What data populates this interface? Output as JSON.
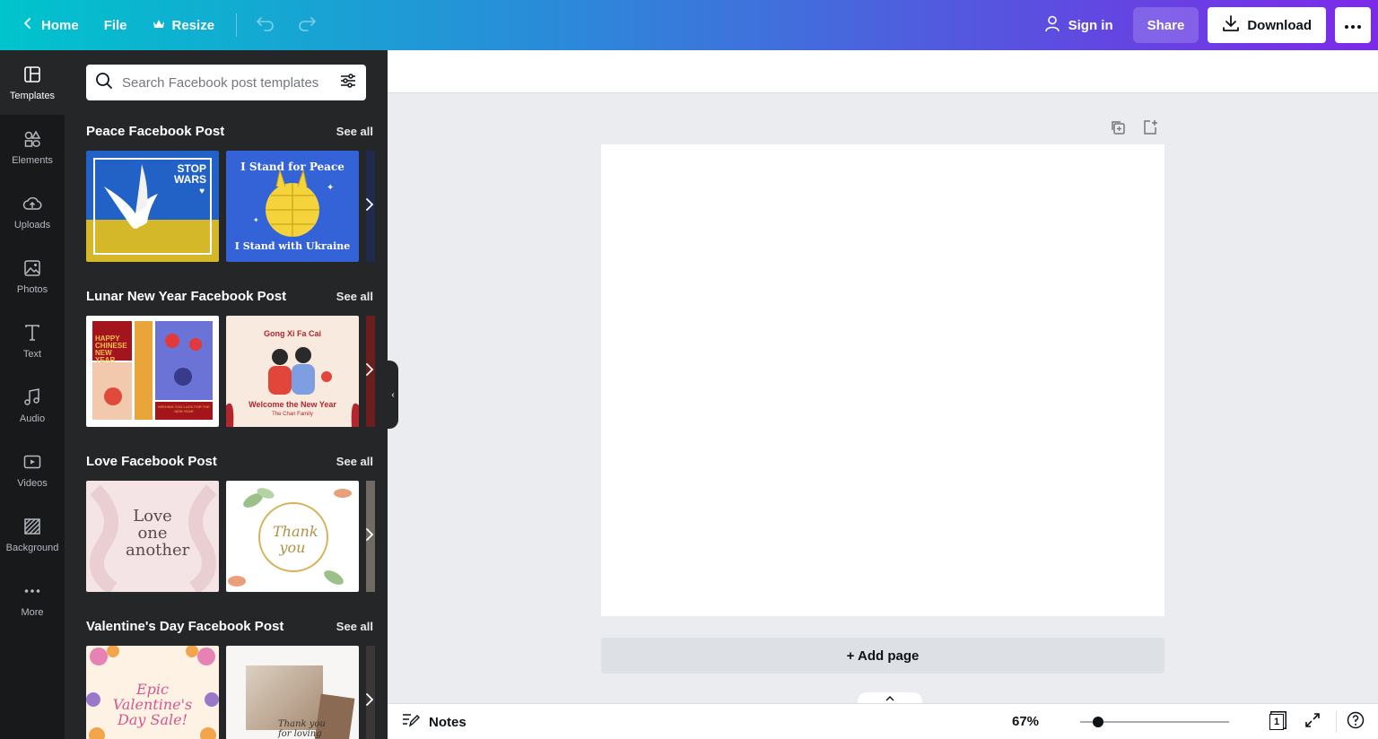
{
  "topbar": {
    "home_label": "Home",
    "file_label": "File",
    "resize_label": "Resize",
    "signin_label": "Sign in",
    "share_label": "Share",
    "download_label": "Download"
  },
  "rail": {
    "items": [
      {
        "label": "Templates",
        "icon": "templates-icon",
        "active": true
      },
      {
        "label": "Elements",
        "icon": "elements-icon"
      },
      {
        "label": "Uploads",
        "icon": "uploads-icon"
      },
      {
        "label": "Photos",
        "icon": "photos-icon"
      },
      {
        "label": "Text",
        "icon": "text-icon"
      },
      {
        "label": "Audio",
        "icon": "audio-icon"
      },
      {
        "label": "Videos",
        "icon": "videos-icon"
      },
      {
        "label": "Background",
        "icon": "background-icon"
      },
      {
        "label": "More",
        "icon": "more-icon"
      }
    ]
  },
  "panel": {
    "search_placeholder": "Search Facebook post templates",
    "see_all": "See all",
    "sections": [
      {
        "title": "Peace Facebook Post",
        "thumbs": [
          {
            "text": "STOP WARS"
          },
          {
            "text_top": "I Stand for Peace",
            "text_bottom": "I Stand with Ukraine"
          }
        ]
      },
      {
        "title": "Lunar New Year Facebook Post",
        "thumbs": [
          {
            "text": "HAPPY CHINESE NEW YEAR",
            "sub": "WISHING YOU LUCK FOR THE NEW YEAR"
          },
          {
            "text_top": "Gong Xi Fa Cai",
            "text_bottom": "Welcome the New Year",
            "sub": "The Chan Family"
          }
        ]
      },
      {
        "title": "Love Facebook Post",
        "thumbs": [
          {
            "text": "Love one another"
          },
          {
            "text": "Thank you"
          }
        ]
      },
      {
        "title": "Valentine's Day Facebook Post",
        "thumbs": [
          {
            "text": "Epic Valentine's Day Sale!"
          },
          {
            "text": "Thank you for loving me!"
          }
        ]
      }
    ]
  },
  "canvas": {
    "add_page_label": "+ Add page"
  },
  "bottombar": {
    "notes_label": "Notes",
    "zoom_label": "67%",
    "zoom_value": 0.12,
    "page_count": "1"
  },
  "colors": {
    "gradient_start": "#00c4cc",
    "gradient_end": "#7d2ae8",
    "rail_bg": "#18191b",
    "panel_bg": "#252627",
    "canvas_bg": "#ebecf0"
  }
}
